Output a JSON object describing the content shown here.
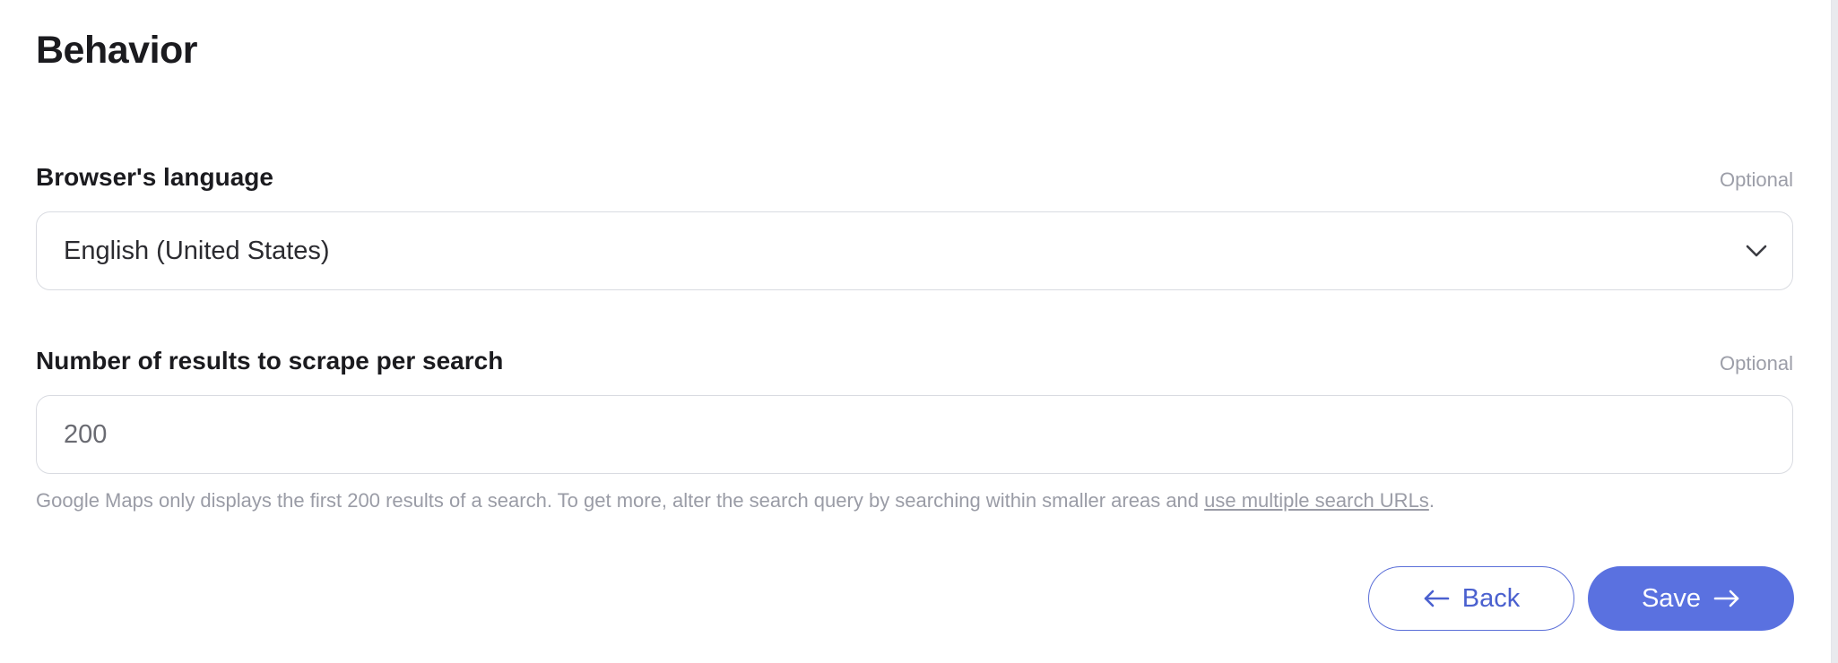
{
  "section": {
    "title": "Behavior"
  },
  "fields": {
    "language": {
      "label": "Browser's language",
      "optional": "Optional",
      "value": "English (United States)"
    },
    "results": {
      "label": "Number of results to scrape per search",
      "optional": "Optional",
      "value": "200",
      "help_text": "Google Maps only displays the first 200 results of a search. To get more, alter the search query by searching within smaller areas and ",
      "help_link": "use multiple search URLs",
      "help_end": "."
    }
  },
  "actions": {
    "back_label": "Back",
    "save_label": "Save"
  },
  "icons": {
    "select": "chevron-down-icon",
    "back": "arrow-left-icon",
    "save": "arrow-right-icon"
  },
  "colors": {
    "accent": "#5a71e0",
    "back_text": "#4a60cf",
    "muted_text": "#9a9ca6"
  }
}
